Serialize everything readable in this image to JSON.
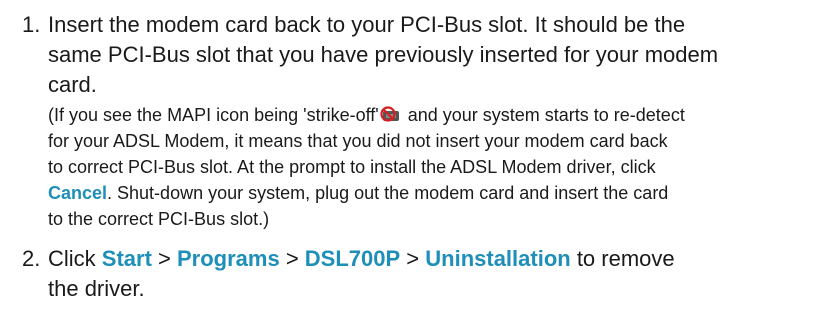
{
  "steps": [
    {
      "number": "1.",
      "lines": [
        "Insert the modem card back to your PCI-Bus slot.  It should be the",
        "same PCI-Bus slot that you have previously inserted for your modem",
        "card."
      ],
      "note": {
        "line1_before_icon": "(If you see the MAPI icon being 'strike-off'",
        "line1_after_icon": " and your system starts to re-detect",
        "line2": "for your ADSL Modem, it means that you did not insert your modem card back",
        "line3": "to correct PCI-Bus slot.  At the prompt to install the ADSL Modem driver, click",
        "line4_keyword": "Cancel",
        "line4_rest": ".  Shut-down your system, plug out the modem card and insert the card",
        "line5": "to the correct PCI-Bus slot.)"
      }
    },
    {
      "number": "2.",
      "click_label": "Click ",
      "path": [
        "Start",
        "Programs",
        "DSL700P",
        "Uninstallation"
      ],
      "separator": " > ",
      "line1_tail": " to remove",
      "line2": "the driver."
    }
  ],
  "colors": {
    "keyword": "#1e8fb8",
    "text": "#1a1a1a",
    "icon_strike": "#d81e1e"
  },
  "icons": {
    "mapi_struck": "mapi-strike-off-icon"
  }
}
